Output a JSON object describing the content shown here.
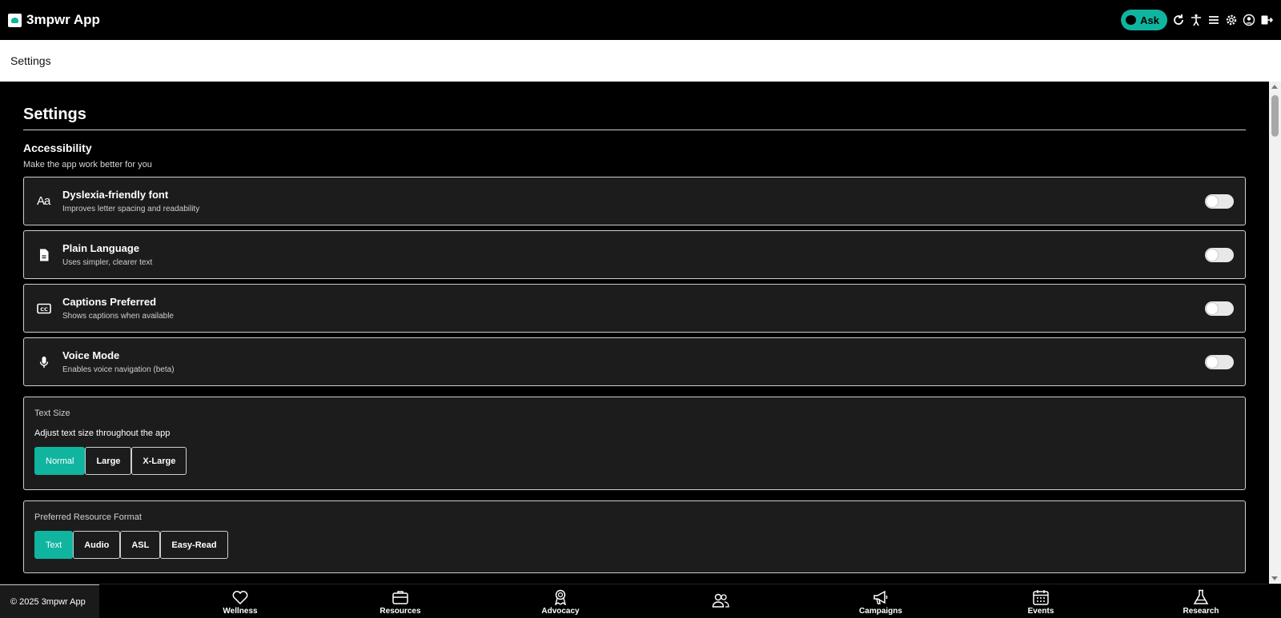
{
  "app": {
    "name": "3mpwr App"
  },
  "topbar": {
    "ask_label": "Ask"
  },
  "breadcrumb": {
    "current": "Settings"
  },
  "page": {
    "title": "Settings",
    "section": {
      "title": "Accessibility",
      "subtitle": "Make the app work better for you"
    }
  },
  "options": [
    {
      "title": "Dyslexia-friendly font",
      "desc": "Improves letter spacing and readability",
      "icon": "Aa",
      "enabled": false
    },
    {
      "title": "Plain Language",
      "desc": "Uses simpler, clearer text",
      "icon": "document-icon",
      "enabled": false
    },
    {
      "title": "Captions Preferred",
      "desc": "Shows captions when available",
      "icon": "captions-icon",
      "enabled": false
    },
    {
      "title": "Voice Mode",
      "desc": "Enables voice navigation (beta)",
      "icon": "microphone-icon",
      "enabled": false
    }
  ],
  "text_size": {
    "label": "Text Size",
    "desc": "Adjust text size throughout the app",
    "options": [
      "Normal",
      "Large",
      "X-Large"
    ],
    "selected": "Normal"
  },
  "resource_format": {
    "label": "Preferred Resource Format",
    "options": [
      "Text",
      "Audio",
      "ASL",
      "Easy-Read"
    ],
    "selected": "Text"
  },
  "footer": {
    "copyright": "© 2025 3mpwr App",
    "nav": [
      {
        "label": "Wellness",
        "icon": "heart-icon"
      },
      {
        "label": "Resources",
        "icon": "briefcase-icon"
      },
      {
        "label": "Advocacy",
        "icon": "award-icon"
      },
      {
        "label": "",
        "icon": "people-icon"
      },
      {
        "label": "Campaigns",
        "icon": "megaphone-icon"
      },
      {
        "label": "Events",
        "icon": "calendar-icon"
      },
      {
        "label": "Research",
        "icon": "flask-icon"
      }
    ]
  },
  "colors": {
    "accent": "#10b5a0",
    "background": "#000000",
    "card": "#1c1c1c"
  }
}
